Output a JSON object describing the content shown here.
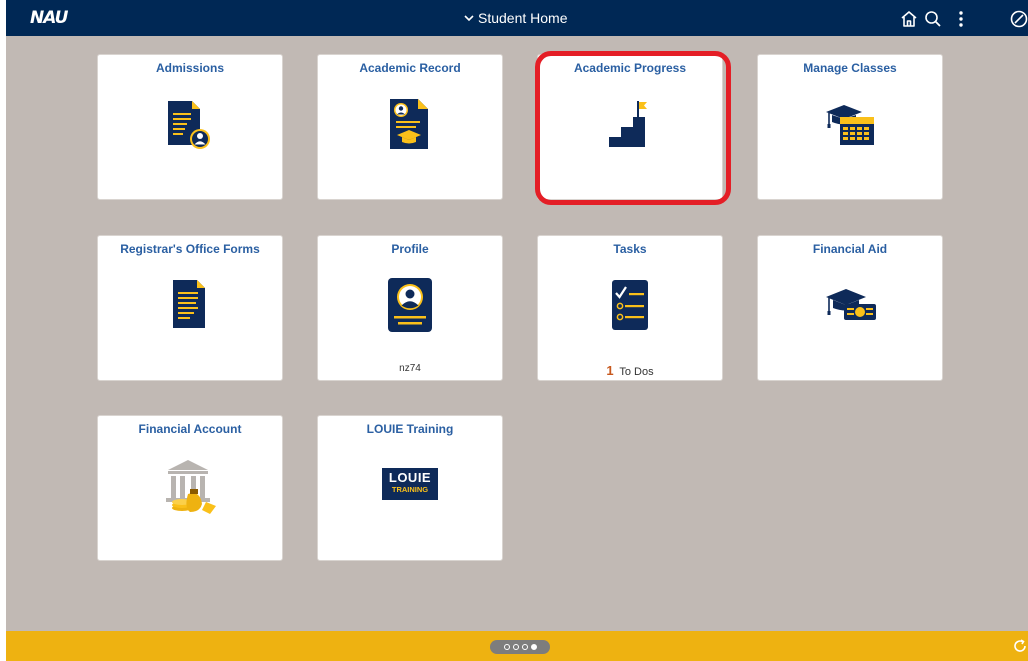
{
  "header": {
    "logo": "NAU",
    "title": "Student Home",
    "icons": [
      "home-icon",
      "search-icon",
      "more-options-icon",
      "compass-icon"
    ]
  },
  "tiles": [
    {
      "title": "Admissions",
      "icon": "admissions-document-icon"
    },
    {
      "title": "Academic Record",
      "icon": "academic-record-icon"
    },
    {
      "title": "Academic Progress",
      "icon": "stairs-flag-icon"
    },
    {
      "title": "Manage Classes",
      "icon": "graduation-calendar-icon"
    },
    {
      "title": "Registrar's Office Forms",
      "icon": "forms-document-icon"
    },
    {
      "title": "Profile",
      "icon": "profile-card-icon",
      "subtitle": "nz74"
    },
    {
      "title": "Tasks",
      "icon": "checklist-icon",
      "count": "1",
      "count_label": "To Dos"
    },
    {
      "title": "Financial Aid",
      "icon": "grad-cap-money-icon"
    },
    {
      "title": "Financial Account",
      "icon": "bank-money-icon"
    },
    {
      "title": "LOUIE Training",
      "icon": "louie-training-logo",
      "logo_line1": "LOUIE",
      "logo_line2": "TRAINING"
    }
  ],
  "pager": {
    "pages": 4,
    "active": 4
  },
  "colors": {
    "header": "#002855",
    "background": "#c1b9b4",
    "footer": "#eeb211",
    "tile_title": "#2a5fa2",
    "highlight": "#e41e26",
    "accent": "#fac01a",
    "count": "#c7581d"
  }
}
